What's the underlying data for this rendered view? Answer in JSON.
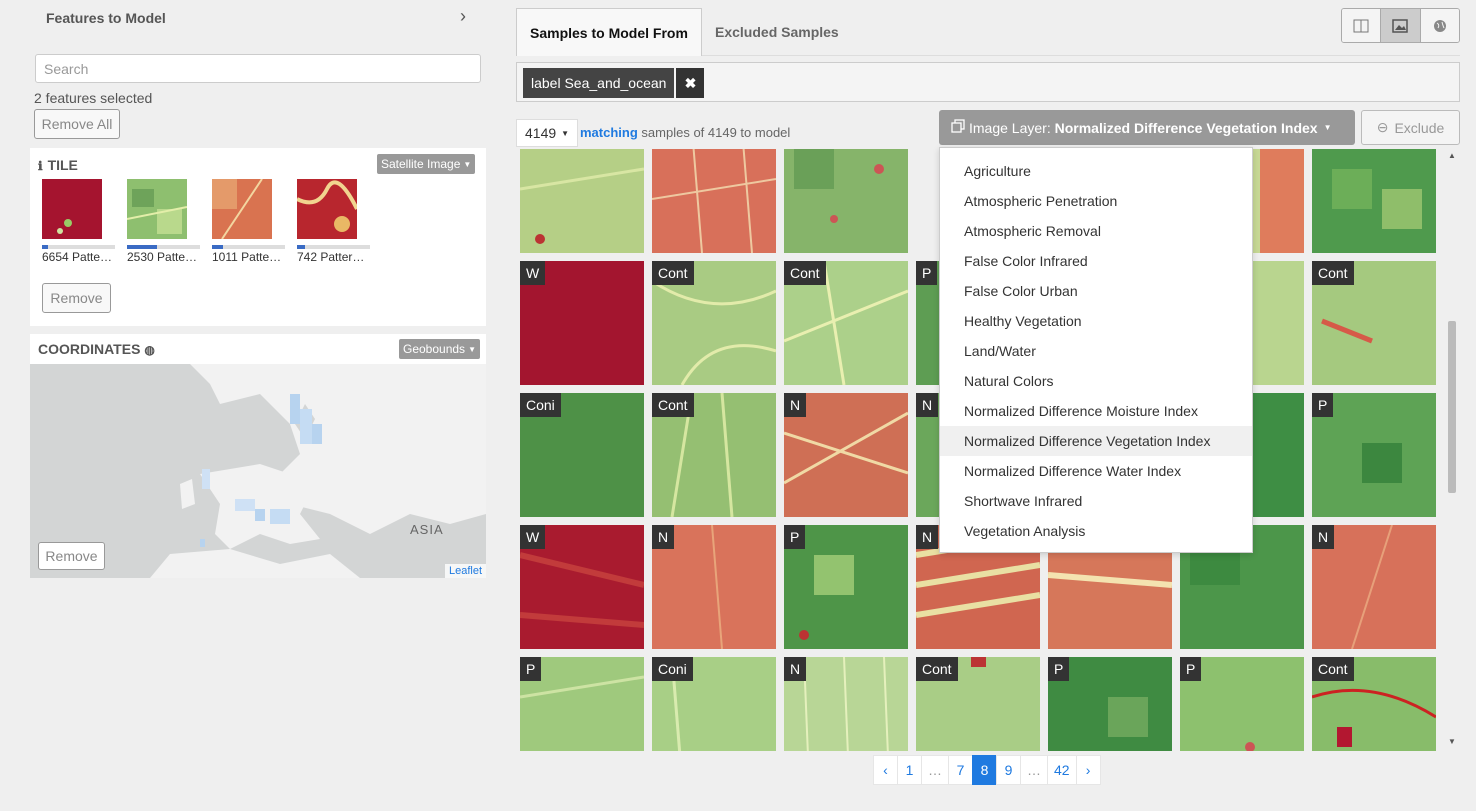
{
  "left": {
    "features_title": "Features to Model",
    "search_placeholder": "Search",
    "selected_text": "2 features selected",
    "remove_all": "Remove All",
    "tile": {
      "title": "TILE",
      "dropdown": "Satellite Image",
      "items": [
        {
          "label": "6654 Patte…",
          "fraction": 0.08
        },
        {
          "label": "2530 Patte…",
          "fraction": 0.41
        },
        {
          "label": "1011 Patte…",
          "fraction": 0.15
        },
        {
          "label": "742 Patter…",
          "fraction": 0.11
        }
      ],
      "remove": "Remove"
    },
    "coords": {
      "title": "COORDINATES",
      "dropdown": "Geobounds",
      "map_label": "ASIA",
      "attribution": "Leaflet",
      "remove": "Remove"
    }
  },
  "tabs": {
    "samples": "Samples to Model From",
    "excluded": "Excluded Samples"
  },
  "filter": {
    "chip": "label Sea_and_ocean"
  },
  "count": {
    "value": "4149",
    "matching": "matching",
    "rest": "samples of 4149 to model"
  },
  "layer": {
    "prefix": "Image Layer:",
    "value": "Normalized Difference Vegetation Index"
  },
  "exclude": "Exclude",
  "menu": [
    "Agriculture",
    "Atmospheric Penetration",
    "Atmospheric Removal",
    "False Color Infrared",
    "False Color Urban",
    "Healthy Vegetation",
    "Land/Water",
    "Natural Colors",
    "Normalized Difference Moisture Index",
    "Normalized Difference Vegetation Index",
    "Normalized Difference Water Index",
    "Shortwave Infrared",
    "Vegetation Analysis"
  ],
  "badges": {
    "r2": [
      "W",
      "Cont",
      "Cont",
      "P",
      "",
      "",
      "Cont"
    ],
    "r3": [
      "Coni",
      "Cont",
      "N",
      "N",
      "",
      "",
      "P"
    ],
    "r4": [
      "W",
      "N",
      "P",
      "N",
      "",
      "",
      "N"
    ],
    "r5": [
      "P",
      "Coni",
      "N",
      "Cont",
      "P",
      "P",
      "Cont"
    ]
  },
  "pager": [
    "‹",
    "1",
    "…",
    "7",
    "8",
    "9",
    "…",
    "42",
    "›"
  ]
}
